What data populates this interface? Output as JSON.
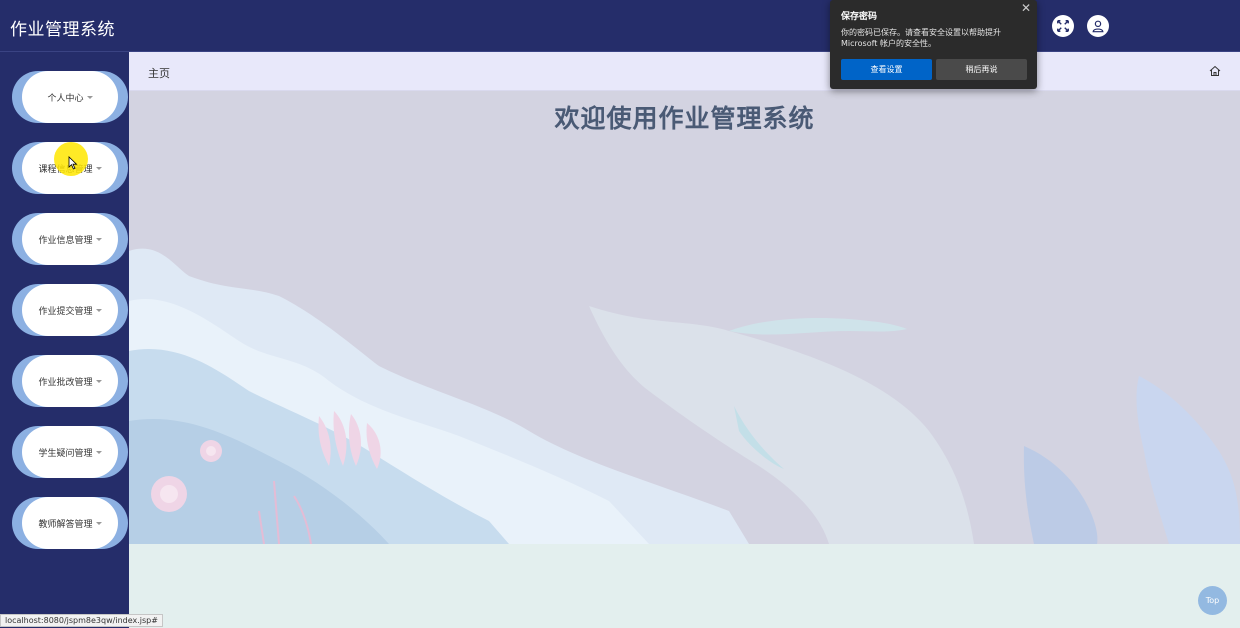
{
  "app": {
    "title": "作业管理系统"
  },
  "topbar": {
    "fullscreen_icon": "fullscreen-icon",
    "user_icon": "user-icon"
  },
  "sidebar": {
    "items": [
      {
        "label": "个人中心"
      },
      {
        "label": "课程信息管理"
      },
      {
        "label": "作业信息管理"
      },
      {
        "label": "作业提交管理"
      },
      {
        "label": "作业批改管理"
      },
      {
        "label": "学生疑问管理"
      },
      {
        "label": "教师解答管理"
      }
    ]
  },
  "breadcrumb": {
    "current": "主页",
    "home_icon": "home-icon"
  },
  "main": {
    "welcome": "欢迎使用作业管理系统"
  },
  "top_button": {
    "label": "Top"
  },
  "status_bar": {
    "url": "localhost:8080/jspm8e3qw/index.jsp#"
  },
  "password_popup": {
    "title": "保存密码",
    "message": "你的密码已保存。请查看安全设置以帮助提升 Microsoft 帐户的安全性。",
    "primary_label": "查看设置",
    "secondary_label": "稍后再说",
    "close_icon": "close-icon"
  },
  "colors": {
    "nav": "#252d6a",
    "menu_accent": "#8cb0e2",
    "popup_primary": "#0064c8"
  }
}
